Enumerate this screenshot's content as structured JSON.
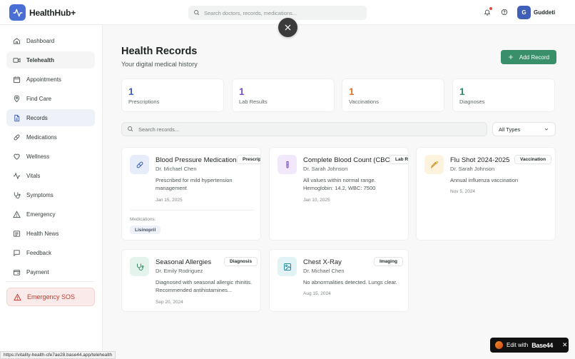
{
  "app": {
    "name": "HealthHub+"
  },
  "header": {
    "search_placeholder": "Search doctors, records, medications...",
    "user": {
      "initial": "G",
      "name": "Guddeti"
    }
  },
  "sidebar": {
    "items": [
      {
        "label": "Dashboard",
        "icon": "home-icon"
      },
      {
        "label": "Telehealth",
        "icon": "video-icon"
      },
      {
        "label": "Appointments",
        "icon": "calendar-icon"
      },
      {
        "label": "Find Care",
        "icon": "location-pin-icon"
      },
      {
        "label": "Records",
        "icon": "file-icon"
      },
      {
        "label": "Medications",
        "icon": "pill-icon"
      },
      {
        "label": "Wellness",
        "icon": "heart-icon"
      },
      {
        "label": "Vitals",
        "icon": "activity-icon"
      },
      {
        "label": "Symptoms",
        "icon": "stethoscope-icon"
      },
      {
        "label": "Emergency",
        "icon": "alert-triangle-icon"
      },
      {
        "label": "Health News",
        "icon": "newspaper-icon"
      },
      {
        "label": "Feedback",
        "icon": "message-icon"
      },
      {
        "label": "Payment",
        "icon": "wallet-icon"
      }
    ],
    "sos_label": "Emergency SOS"
  },
  "main": {
    "title": "Health Records",
    "subtitle": "Your digital medical history",
    "add_button": "Add Record",
    "stats": [
      {
        "value": "1",
        "label": "Prescriptions",
        "color": "#3f5fb8"
      },
      {
        "value": "1",
        "label": "Lab Results",
        "color": "#7b4fc4"
      },
      {
        "value": "1",
        "label": "Vaccinations",
        "color": "#e0772e"
      },
      {
        "value": "1",
        "label": "Diagnoses",
        "color": "#2f8a63"
      }
    ],
    "search_placeholder": "Search records...",
    "type_filter": "All Types",
    "records": [
      {
        "title": "Blood Pressure Medication",
        "badge": "Prescription",
        "doctor": "Dr. Michael Chen",
        "description": "Prescribed for mild hypertension management",
        "date": "Jan 15, 2025",
        "icon": "pill-icon",
        "icon_bg": "#e6ecf9",
        "icon_color": "#3f5fb8",
        "medications_label": "Medications:",
        "medications": [
          "Lisinopril"
        ]
      },
      {
        "title": "Complete Blood Count (CBC)",
        "badge": "Lab Result",
        "doctor": "Dr. Sarah Johnson",
        "description": "All values within normal range. Hemoglobin: 14.2, WBC: 7500",
        "date": "Jan 10, 2025",
        "icon": "test-tube-icon",
        "icon_bg": "#f1e9fb",
        "icon_color": "#7b4fc4"
      },
      {
        "title": "Flu Shot 2024-2025",
        "badge": "Vaccination",
        "doctor": "Dr. Sarah Johnson",
        "description": "Annual influenza vaccination",
        "date": "Nov 5, 2024",
        "icon": "syringe-icon",
        "icon_bg": "#fdf3dc",
        "icon_color": "#c98a12"
      },
      {
        "title": "Seasonal Allergies",
        "badge": "Diagnosis",
        "doctor": "Dr. Emily Rodriguez",
        "description": "Diagnosed with seasonal allergic rhinitis. Recommended antihistamines...",
        "date": "Sep 20, 2024",
        "icon": "stethoscope-icon",
        "icon_bg": "#e4f4ec",
        "icon_color": "#2f8a63"
      },
      {
        "title": "Chest X-Ray",
        "badge": "Imaging",
        "doctor": "Dr. Michael Chen",
        "description": "No abnormalities detected. Lungs clear.",
        "date": "Aug 15, 2024",
        "icon": "image-icon",
        "icon_bg": "#e2f3f6",
        "icon_color": "#2a8a9e"
      }
    ]
  },
  "status_url": "https://vitality-health-cfe7ae28.base44.app/telehealth",
  "edit_badge": {
    "prefix": "Edit with",
    "brand": "Base44"
  }
}
